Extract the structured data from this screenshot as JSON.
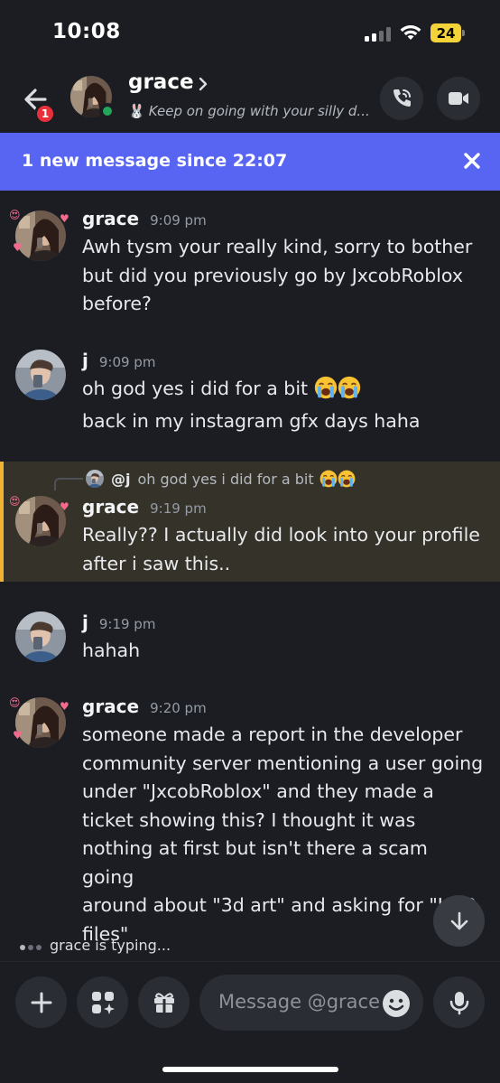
{
  "status_bar": {
    "time": "10:08",
    "battery": "24"
  },
  "header": {
    "back_badge": "1",
    "name": "grace",
    "status_emoji": "🐰",
    "status_text": "Keep on going with your silly d..."
  },
  "banner": {
    "text": "1 new message since 22:07"
  },
  "messages": [
    {
      "author": "grace",
      "time": "9:09 pm",
      "lines": [
        "Awh tysm your really kind, sorry to bother",
        "but did you previously go by JxcobRoblox",
        "before?"
      ]
    },
    {
      "author": "j",
      "time": "9:09 pm",
      "lines": [
        "oh god yes i did for a bit",
        "back in my instagram gfx days haha"
      ]
    },
    {
      "author": "grace",
      "time": "9:19 pm",
      "reply_author": "@j",
      "reply_text": "oh god yes i did for a bit",
      "lines": [
        "Really?? I actually did look into your profile",
        "after i saw this.."
      ]
    },
    {
      "author": "j",
      "time": "9:19 pm",
      "lines": [
        "hahah"
      ]
    },
    {
      "author": "grace",
      "time": "9:20 pm",
      "lines": [
        "someone made a report in the developer",
        "community server mentioning a user going",
        "under \"JxcobRoblox\" and they made a",
        "ticket showing this? I thought it was",
        "nothing at first but isn't there a scam going",
        "around about \"3d art\" and asking for \"HAR",
        "files\""
      ]
    }
  ],
  "typing": {
    "text": "grace is typing..."
  },
  "composer": {
    "placeholder": "Message @grace"
  },
  "icons": {
    "back": "arrow-left-icon",
    "call": "phone-call-icon",
    "video": "video-camera-icon",
    "close": "close-icon",
    "scroll": "arrow-down-icon",
    "plus": "plus-icon",
    "apps": "apps-sparkle-icon",
    "gift": "gift-icon",
    "emoji": "smiley-icon",
    "mic": "microphone-icon",
    "crying": "loudly-crying-emoji"
  },
  "colors": {
    "background": "#1c1d23",
    "banner": "#5865f2",
    "online": "#23a55a",
    "badge": "#e8303a",
    "highlight": "#f0b232"
  }
}
